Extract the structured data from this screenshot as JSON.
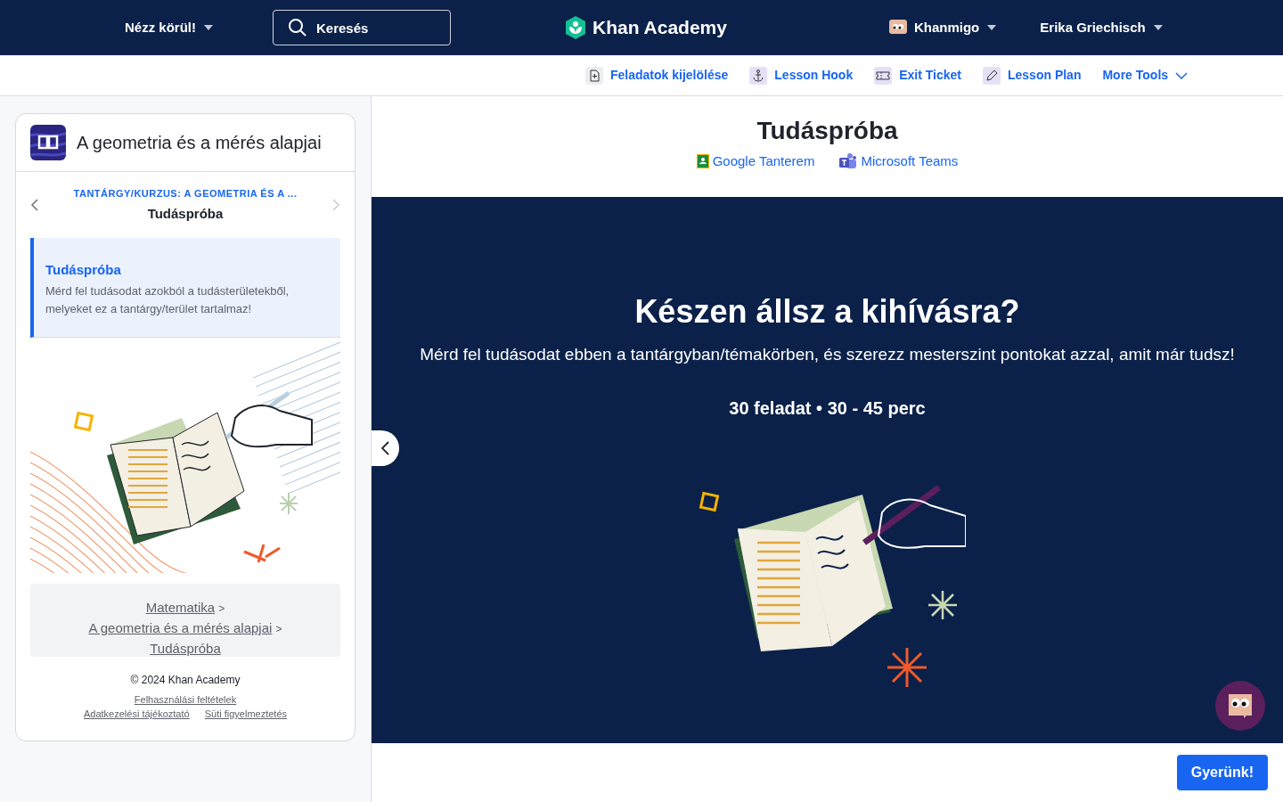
{
  "header": {
    "explore_menu": "Nézz körül!",
    "search": {
      "placeholder": "Keresés"
    },
    "logo": "Khan Academy",
    "khanmigo": "Khanmigo",
    "user": "Erika Griechisch"
  },
  "toolbar": [
    {
      "label": "Feladatok kijelölése",
      "kind": "assign"
    },
    {
      "label": "Lesson Hook",
      "kind": "hook"
    },
    {
      "label": "Exit Ticket",
      "kind": "ticket"
    },
    {
      "label": "Lesson Plan",
      "kind": "plan"
    },
    {
      "label": "More Tools",
      "kind": "more"
    }
  ],
  "sidebar": {
    "course_title": "A geometria és a mérés alapjai",
    "unit_label": "TANTÁRGY/KURZUS: A GEOMETRIA ÉS A ...",
    "current": "Tudáspróba",
    "items": [
      {
        "title": "Tudáspróba",
        "description": "Mérd fel tudásodat azokból a tudásterületekből, melyeket ez a tantárgy/terület tartalmaz!",
        "selected": true
      }
    ],
    "path": [
      {
        "label": "Matematika",
        "separator": ">"
      },
      {
        "label": "A geometria és a mérés alapjai",
        "separator": ">"
      },
      {
        "label": "Tudáspróba"
      }
    ],
    "copyright": "© 2024 Khan Academy",
    "footer_links": [
      "Felhasználási feltételek",
      "Adatkezelési tájékoztató",
      "Süti figyelmeztetés"
    ]
  },
  "main": {
    "title": "Tudáspróba",
    "share_links": [
      {
        "label": "Google Tanterem",
        "kind": "classroom"
      },
      {
        "label": "Microsoft Teams",
        "kind": "teams"
      }
    ],
    "heading": "Készen állsz a kihívásra?",
    "description": "Mérd fel tudásodat ebben a tantárgyban/témakörben, és szerezz mesterszint pontokat azzal, amit már tudsz!",
    "meta": "30 feladat • 30 - 45 perc",
    "start_button": "Gyerünk!"
  }
}
